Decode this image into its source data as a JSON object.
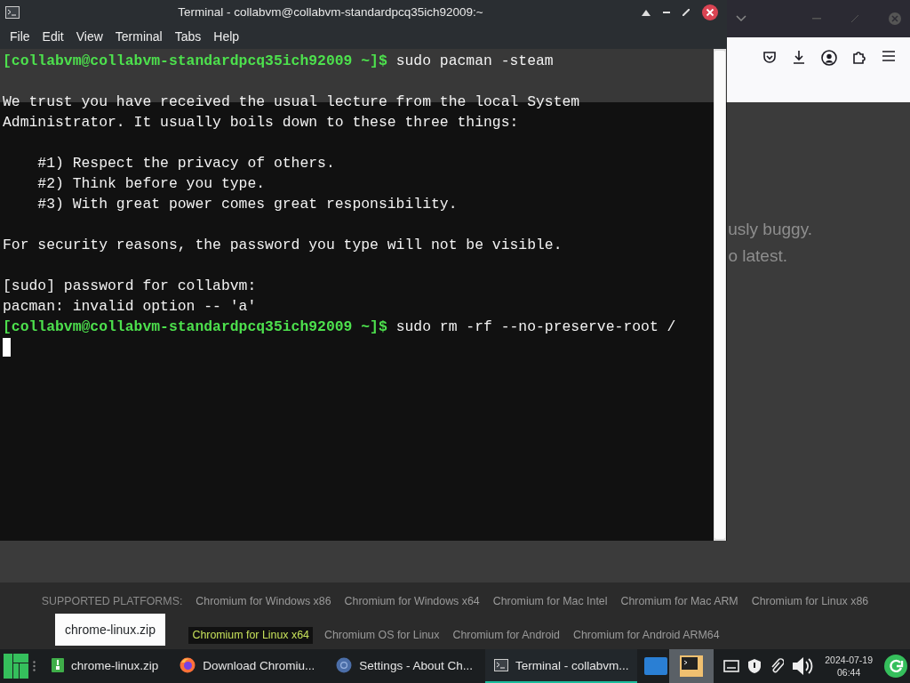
{
  "terminal": {
    "title": "Terminal - collabvm@collabvm-standardpcq35ich92009:~",
    "menu": [
      "File",
      "Edit",
      "View",
      "Terminal",
      "Tabs",
      "Help"
    ],
    "lines": [
      {
        "kind": "prompt",
        "prompt": "[collabvm@collabvm-standardpcq35ich92009 ~]$",
        "command": "sudo pacman -steam"
      },
      {
        "kind": "blank"
      },
      {
        "kind": "output",
        "text": "We trust you have received the usual lecture from the local System"
      },
      {
        "kind": "output",
        "text": "Administrator. It usually boils down to these three things:"
      },
      {
        "kind": "blank"
      },
      {
        "kind": "output",
        "text": "    #1) Respect the privacy of others."
      },
      {
        "kind": "output",
        "text": "    #2) Think before you type."
      },
      {
        "kind": "output",
        "text": "    #3) With great power comes great responsibility."
      },
      {
        "kind": "blank"
      },
      {
        "kind": "output",
        "text": "For security reasons, the password you type will not be visible."
      },
      {
        "kind": "blank"
      },
      {
        "kind": "output",
        "text": "[sudo] password for collabvm:"
      },
      {
        "kind": "output",
        "text": "pacman: invalid option -- 'a'"
      },
      {
        "kind": "prompt",
        "prompt": "[collabvm@collabvm-standardpcq35ich92009 ~]$",
        "command": "sudo rm -rf --no-preserve-root /"
      },
      {
        "kind": "cursor"
      }
    ]
  },
  "browser": {
    "notice": [
      "usly buggy.",
      "o latest."
    ],
    "platforms_label": "SUPPORTED PLATFORMS:",
    "platforms": [
      {
        "label": "Chromium for Windows x86",
        "highlighted": false
      },
      {
        "label": "Chromium for Windows x64",
        "highlighted": false
      },
      {
        "label": "Chromium for Mac Intel",
        "highlighted": false
      },
      {
        "label": "Chromium for Mac ARM",
        "highlighted": false
      },
      {
        "label": "Chromium for Linux x86",
        "highlighted": false
      },
      {
        "label": "Chromium for Linux x64",
        "highlighted": true
      },
      {
        "label": "Chromium OS for Linux",
        "highlighted": false
      },
      {
        "label": "Chromium for Android",
        "highlighted": false
      },
      {
        "label": "Chromium for Android ARM64",
        "highlighted": false
      }
    ]
  },
  "tooltip": "chrome-linux.zip",
  "taskbar": {
    "tasks": [
      {
        "label": "chrome-linux.zip",
        "kind": "archive",
        "selected": false
      },
      {
        "label": "Download Chromiu...",
        "kind": "firefox",
        "selected": false
      },
      {
        "label": "Settings - About Ch...",
        "kind": "chromium",
        "selected": false
      },
      {
        "label": "Terminal - collabvm...",
        "kind": "terminal",
        "selected": true
      }
    ],
    "date": "2024-07-19",
    "time": "06:44"
  }
}
